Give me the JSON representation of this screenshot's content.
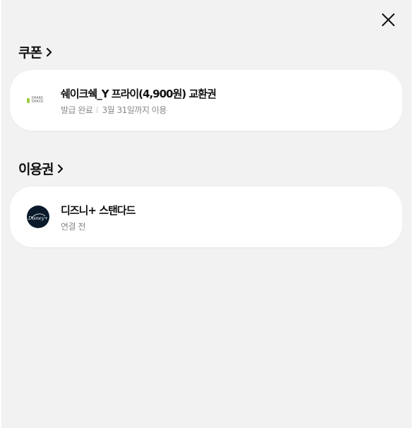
{
  "close": {
    "icon": "close-icon"
  },
  "coupon_section": {
    "title": "쿠폰",
    "chevron_icon": "chevron-right-icon"
  },
  "coupon_card": {
    "brand_logo_text": "SHAKE SHACK",
    "title": "쉐이크쉑_Y 프라이(4,900원) 교환권",
    "status": "발급 완료",
    "expiry": "3월 31일까지 이용",
    "accent_color": "#9ccb3b"
  },
  "pass_section": {
    "title": "이용권",
    "chevron_icon": "chevron-right-icon"
  },
  "pass_card": {
    "logo_text": "Disney+",
    "title": "디즈니+ 스탠다드",
    "status": "연결 전",
    "logo_bg": "#0a1a2b"
  }
}
